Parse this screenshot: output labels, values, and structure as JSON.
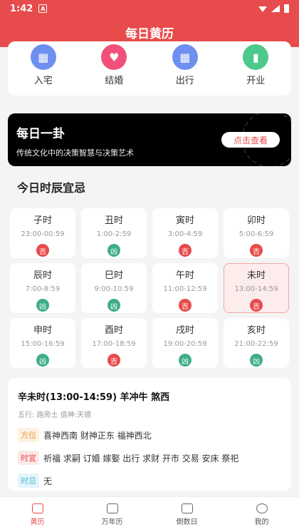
{
  "status": {
    "time": "1:42",
    "a_icon": "A"
  },
  "app": {
    "title": "每日黄历"
  },
  "quick_actions": [
    {
      "label": "入宅",
      "icon": "building-icon",
      "color": "#6e8ef0",
      "glyph": "▦"
    },
    {
      "label": "结婚",
      "icon": "heart-icon",
      "color": "#f0507a",
      "glyph": "♥"
    },
    {
      "label": "出行",
      "icon": "building-icon",
      "color": "#6e8ef0",
      "glyph": "▦"
    },
    {
      "label": "开业",
      "icon": "door-icon",
      "color": "#4cc98b",
      "glyph": "▮"
    }
  ],
  "banner": {
    "title": "每日一卦",
    "subtitle": "传统文化中的决策智慧与决策艺术",
    "button": "点击查看"
  },
  "section": {
    "title": "今日时辰宜忌"
  },
  "hours": [
    {
      "name": "子时",
      "range": "23:00-00:59",
      "verdict": "吉",
      "good": true,
      "active": false
    },
    {
      "name": "丑时",
      "range": "1:00-2:59",
      "verdict": "凶",
      "good": false,
      "active": false
    },
    {
      "name": "寅时",
      "range": "3:00-4:59",
      "verdict": "吉",
      "good": true,
      "active": false
    },
    {
      "name": "卯时",
      "range": "5:00-6:59",
      "verdict": "吉",
      "good": true,
      "active": false
    },
    {
      "name": "辰时",
      "range": "7:00-8:59",
      "verdict": "凶",
      "good": false,
      "active": false
    },
    {
      "name": "巳时",
      "range": "9:00-10:59",
      "verdict": "凶",
      "good": false,
      "active": false
    },
    {
      "name": "午时",
      "range": "11:00-12:59",
      "verdict": "吉",
      "good": true,
      "active": false
    },
    {
      "name": "未时",
      "range": "13:00-14:59",
      "verdict": "吉",
      "good": true,
      "active": true
    },
    {
      "name": "申时",
      "range": "15:00-16:59",
      "verdict": "凶",
      "good": false,
      "active": false
    },
    {
      "name": "酉时",
      "range": "17:00-18:59",
      "verdict": "吉",
      "good": true,
      "active": false
    },
    {
      "name": "戌时",
      "range": "19:00-20:59",
      "verdict": "凶",
      "good": false,
      "active": false
    },
    {
      "name": "亥时",
      "range": "21:00-22:59",
      "verdict": "凶",
      "good": false,
      "active": false
    }
  ],
  "detail": {
    "title": "辛未时(13:00-14:59) 羊冲牛 煞西",
    "subtitle": "五行: 路旁土 值神:天德",
    "direction_tag": "方位",
    "direction_text": "喜神西南 财神正东 福神西北",
    "yi_tag": "时宜",
    "yi_text": "祈福 求嗣 订婚 嫁娶 出行 求财 开市 交易 安床 祭祀",
    "ji_tag": "时忌",
    "ji_text": "无"
  },
  "nav": [
    {
      "label": "黄历",
      "icon": "almanac-icon",
      "active": true
    },
    {
      "label": "万年历",
      "icon": "calendar-icon",
      "active": false
    },
    {
      "label": "倒数日",
      "icon": "hourglass-icon",
      "active": false
    },
    {
      "label": "我的",
      "icon": "profile-icon",
      "active": false
    }
  ],
  "colors": {
    "accent": "#e84b4b",
    "good": "#e84b4b",
    "bad": "#3fae85"
  }
}
